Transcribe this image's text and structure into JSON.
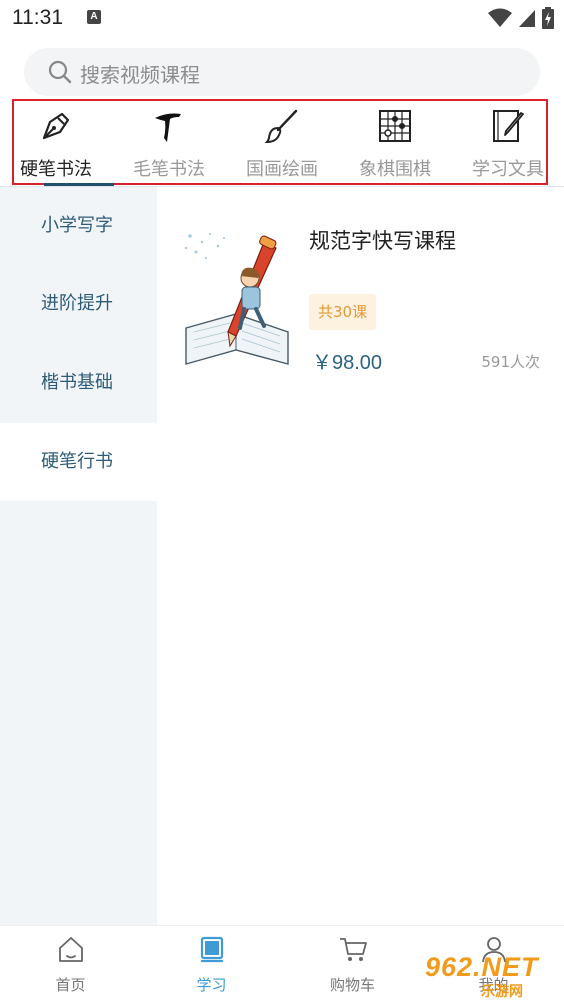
{
  "status_bar": {
    "time": "11:31",
    "notification_glyph": "A"
  },
  "search": {
    "placeholder": "搜索视频课程"
  },
  "categories": [
    {
      "label": "硬笔书法",
      "icon": "fountain-pen-icon",
      "active": true
    },
    {
      "label": "毛笔书法",
      "icon": "brush-stroke-icon",
      "active": false
    },
    {
      "label": "国画绘画",
      "icon": "paintbrush-icon",
      "active": false
    },
    {
      "label": "象棋围棋",
      "icon": "chessboard-icon",
      "active": false
    },
    {
      "label": "学习文具",
      "icon": "notebook-pen-icon",
      "active": false
    }
  ],
  "sidebar": {
    "items": [
      {
        "label": "小学写字",
        "active": false
      },
      {
        "label": "进阶提升",
        "active": false
      },
      {
        "label": "楷书基础",
        "active": false
      },
      {
        "label": "硬笔行书",
        "active": true
      }
    ]
  },
  "course": {
    "title": "规范字快写课程",
    "tag": "共30课",
    "price": "￥98.00",
    "count": "591人次"
  },
  "bottom_nav": {
    "items": [
      {
        "label": "首页",
        "icon": "home-icon",
        "active": false
      },
      {
        "label": "学习",
        "icon": "book-icon",
        "active": true
      },
      {
        "label": "购物车",
        "icon": "cart-icon",
        "active": false
      },
      {
        "label": "我的",
        "icon": "user-icon",
        "active": false
      }
    ]
  },
  "watermark": {
    "main": "962.NET",
    "sub": "乐游网"
  },
  "colors": {
    "highlight_box": "#d7212b",
    "accent": "#1f4f6f",
    "sidebar_text": "#2d5b78",
    "tag_text": "#e39a37",
    "tag_bg": "#fdf1e0",
    "nav_active": "#3e9bd6",
    "watermark": "#f29a1a"
  }
}
